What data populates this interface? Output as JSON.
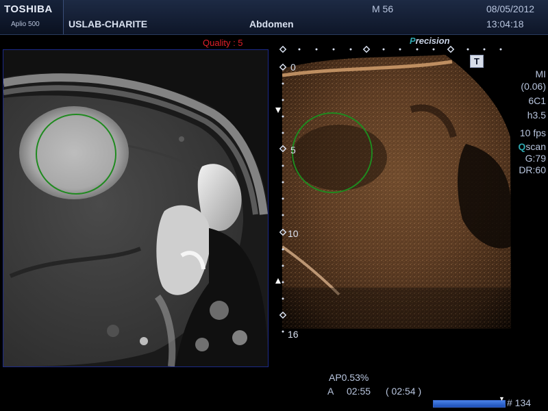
{
  "header": {
    "brand": "TOSHIBA",
    "model": "Aplio 500",
    "institution": "USLAB-CHARITE",
    "preset": "Abdomen",
    "patient": "M 56",
    "date": "08/05/2012",
    "time": "13:04:18"
  },
  "mri": {
    "quality_label": "Quality : 5",
    "roi_color": "#1f8a1f"
  },
  "ultrasound": {
    "precision_prefix": "P",
    "precision_rest": "recision",
    "t_badge": "T",
    "depth_labels": [
      "0",
      "5",
      "10",
      "16"
    ],
    "params": {
      "mi_label": "MI",
      "mi_value": "(0.06)",
      "probe": "6C1",
      "harmonic": "h3.5",
      "fps": "10 fps",
      "qscan_prefix": "Q",
      "qscan_rest": "scan",
      "gain": "G:79",
      "dynamic_range": "DR:60"
    },
    "accent_color": "#2fa8b0",
    "roi_color": "#1f8a1f"
  },
  "footer": {
    "ap": "AP0.53%",
    "clip_mode": "A",
    "clip_time": "02:55",
    "clip_time_paren": "( 02:54 )",
    "frame": "# 134"
  }
}
